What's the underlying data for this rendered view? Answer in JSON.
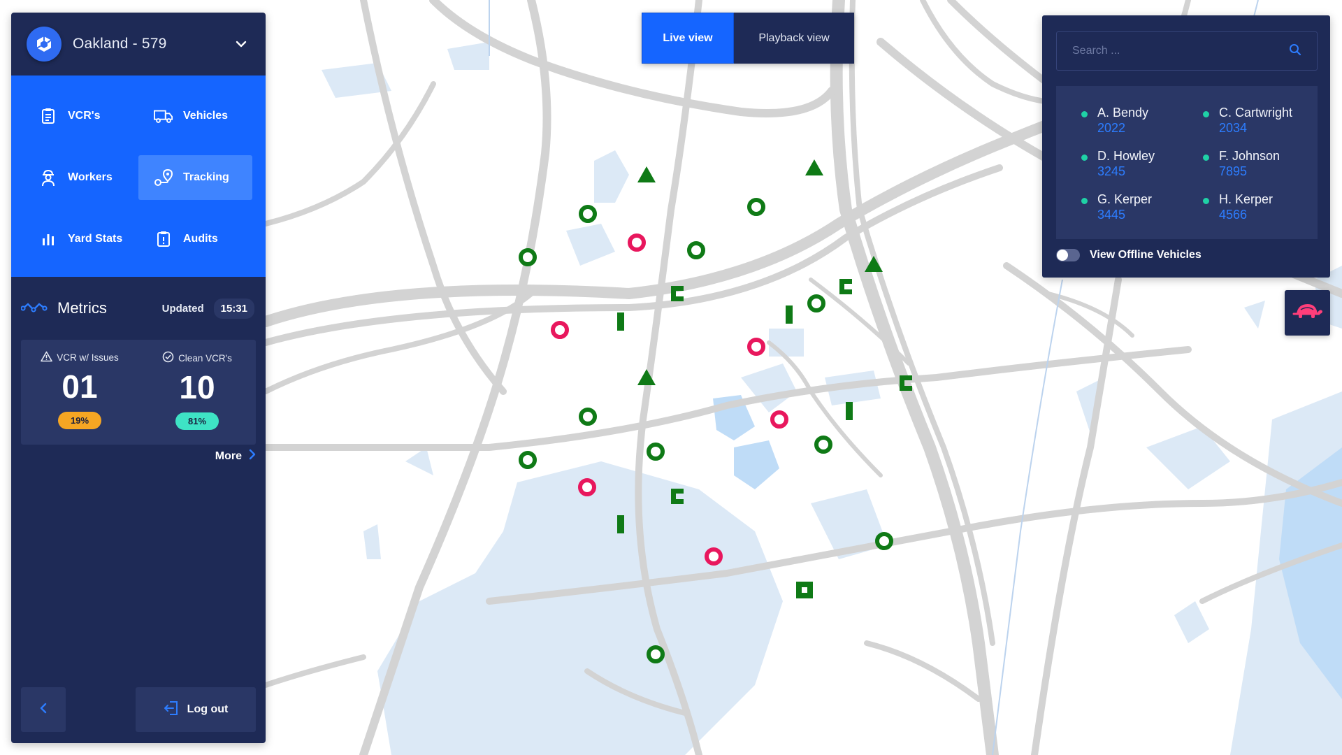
{
  "header": {
    "location": "Oakland - 579"
  },
  "nav": {
    "items": [
      {
        "label": "VCR's",
        "icon": "clipboard-list-icon"
      },
      {
        "label": "Vehicles",
        "icon": "truck-icon"
      },
      {
        "label": "Workers",
        "icon": "worker-icon"
      },
      {
        "label": "Tracking",
        "icon": "route-pin-icon",
        "active": true
      },
      {
        "label": "Yard Stats",
        "icon": "bar-chart-icon"
      },
      {
        "label": "Audits",
        "icon": "clipboard-alert-icon"
      }
    ]
  },
  "metrics": {
    "title": "Metrics",
    "updated_label": "Updated",
    "updated_time": "15:31",
    "issues": {
      "label": "VCR w/ Issues",
      "value": "01",
      "percent": "19%"
    },
    "clean": {
      "label": "Clean VCR's",
      "value": "10",
      "percent": "81%"
    },
    "more_label": "More"
  },
  "footer": {
    "logout_label": "Log out"
  },
  "view_toggle": {
    "live": "Live view",
    "playback": "Playback view",
    "selected": "live"
  },
  "search": {
    "placeholder": "Search ..."
  },
  "users": [
    {
      "name": "A. Bendy",
      "id": "2022"
    },
    {
      "name": "C. Cartwright",
      "id": "2034"
    },
    {
      "name": "D. Howley",
      "id": "3245"
    },
    {
      "name": "F. Johnson",
      "id": "7895"
    },
    {
      "name": "G. Kerper",
      "id": "3445"
    },
    {
      "name": "H. Kerper",
      "id": "4566"
    }
  ],
  "offline_toggle": {
    "label": "View Offline Vehicles",
    "on": false
  },
  "colors": {
    "panel": "#1e2a56",
    "panel_light": "#2a3766",
    "accent": "#1565ff",
    "link": "#2d7dff",
    "online_dot": "#1fd1a6",
    "marker_green": "#0f7a16",
    "marker_red": "#e8175d",
    "badge_orange": "#f6a623",
    "badge_teal": "#3ee3c5",
    "turtle": "#ff3e7a"
  }
}
